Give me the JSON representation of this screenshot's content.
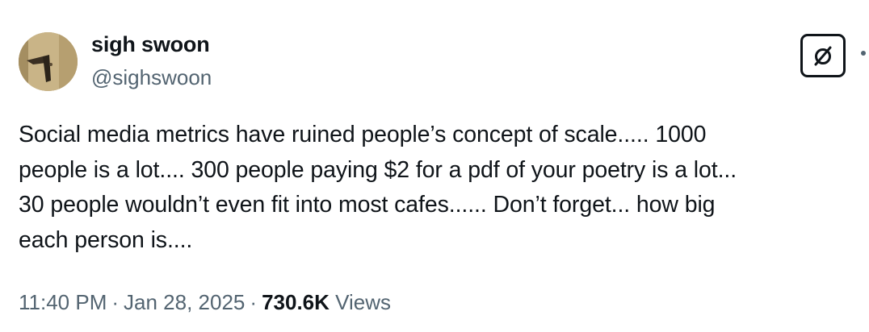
{
  "author": {
    "display_name": "sigh swoon",
    "handle": "@sighswoon"
  },
  "tweet": {
    "text": "Social media metrics have ruined people’s concept of scale..... 1000\npeople is a lot.... 300 people paying $2 for a pdf of your poetry is a lot...\n30 people wouldn’t even fit into most cafes...... Don’t forget... how big\neach person is....",
    "time": "11:40 PM",
    "date": "Jan 28, 2025",
    "separator": "·",
    "views_count": "730.6K",
    "views_label": "Views"
  },
  "icons": {
    "grok": "slashed-square-icon",
    "more": "more-dots-icon"
  },
  "colors": {
    "text": "#0f1419",
    "secondary": "#536471",
    "background": "#ffffff"
  }
}
